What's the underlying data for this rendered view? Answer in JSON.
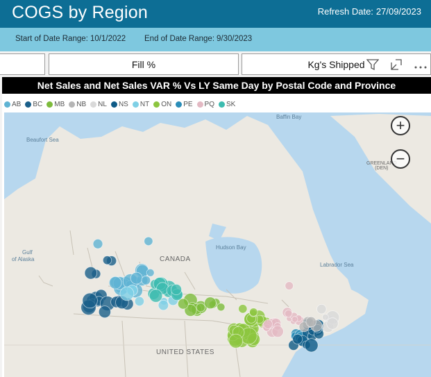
{
  "header": {
    "title": "COGS by Region",
    "refresh_label": "Refresh Date:",
    "refresh_date": "27/09/2023"
  },
  "date_range": {
    "start_label": "Start of Date Range:",
    "start_value": "10/1/2022",
    "end_label": "End of Date Range:",
    "end_value": "9/30/2023"
  },
  "tabs": [
    {
      "label": ""
    },
    {
      "label": "Fill %"
    },
    {
      "label": "Kg's Shipped"
    }
  ],
  "visual": {
    "title": "Net Sales and Net Sales VAR % Vs LY Same Day by Postal Code and Province",
    "legend": [
      {
        "label": "AB",
        "color": "#5fb3d3"
      },
      {
        "label": "BC",
        "color": "#1a5f8a"
      },
      {
        "label": "MB",
        "color": "#7dbb3c"
      },
      {
        "label": "NB",
        "color": "#b5b5b5"
      },
      {
        "label": "NL",
        "color": "#d9d9d9"
      },
      {
        "label": "NS",
        "color": "#0e5a86"
      },
      {
        "label": "NT",
        "color": "#7fd0e6"
      },
      {
        "label": "ON",
        "color": "#8cc53f"
      },
      {
        "label": "PE",
        "color": "#2a8db8"
      },
      {
        "label": "PQ",
        "color": "#e3b9c3"
      },
      {
        "label": "SK",
        "color": "#3dbcb0"
      }
    ]
  },
  "map": {
    "labels": {
      "baffin_bay": "Baffin Bay",
      "beaufort_sea": "Beaufort Sea",
      "greenland": "GREENLAND",
      "greenland_den": "(DEN)",
      "gulf_alaska_1": "Gulf",
      "gulf_alaska_2": "of Alaska",
      "canada": "CANADA",
      "hudson_bay": "Hudson Bay",
      "labrador_sea": "Labrador Sea",
      "united_states": "UNITED STATES"
    },
    "zoom_in": "+",
    "zoom_out": "−"
  }
}
